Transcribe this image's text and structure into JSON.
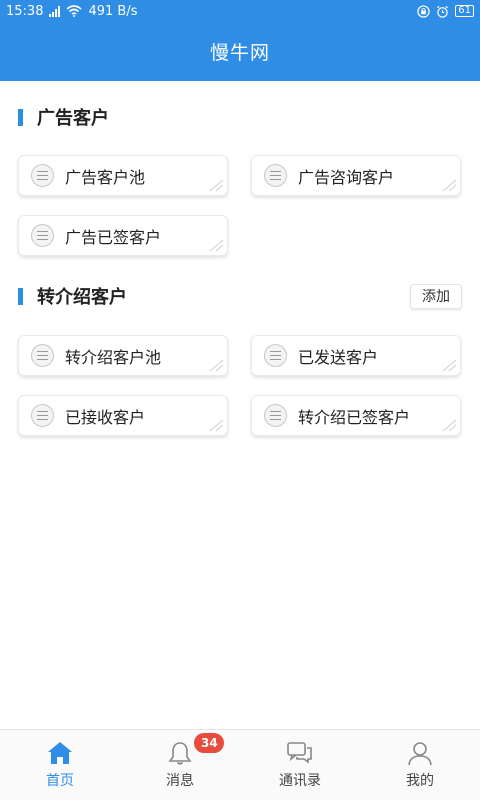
{
  "status": {
    "time": "15:38",
    "network": "4G",
    "speed": "491 B/s",
    "battery": "61"
  },
  "header": {
    "title": "慢牛网"
  },
  "sections": [
    {
      "title": "广告客户",
      "items": [
        "广告客户池",
        "广告咨询客户",
        "广告已签客户"
      ]
    },
    {
      "title": "转介绍客户",
      "action": "添加",
      "items": [
        "转介绍客户池",
        "已发送客户",
        "已接收客户",
        "转介绍已签客户"
      ]
    }
  ],
  "tabs": [
    {
      "label": "首页",
      "icon": "home-icon",
      "active": true
    },
    {
      "label": "消息",
      "icon": "bell-icon",
      "badge": "34"
    },
    {
      "label": "通讯录",
      "icon": "chat-icon"
    },
    {
      "label": "我的",
      "icon": "user-icon"
    }
  ],
  "colors": {
    "primary": "#2f8de6",
    "badge": "#e74c3c"
  }
}
